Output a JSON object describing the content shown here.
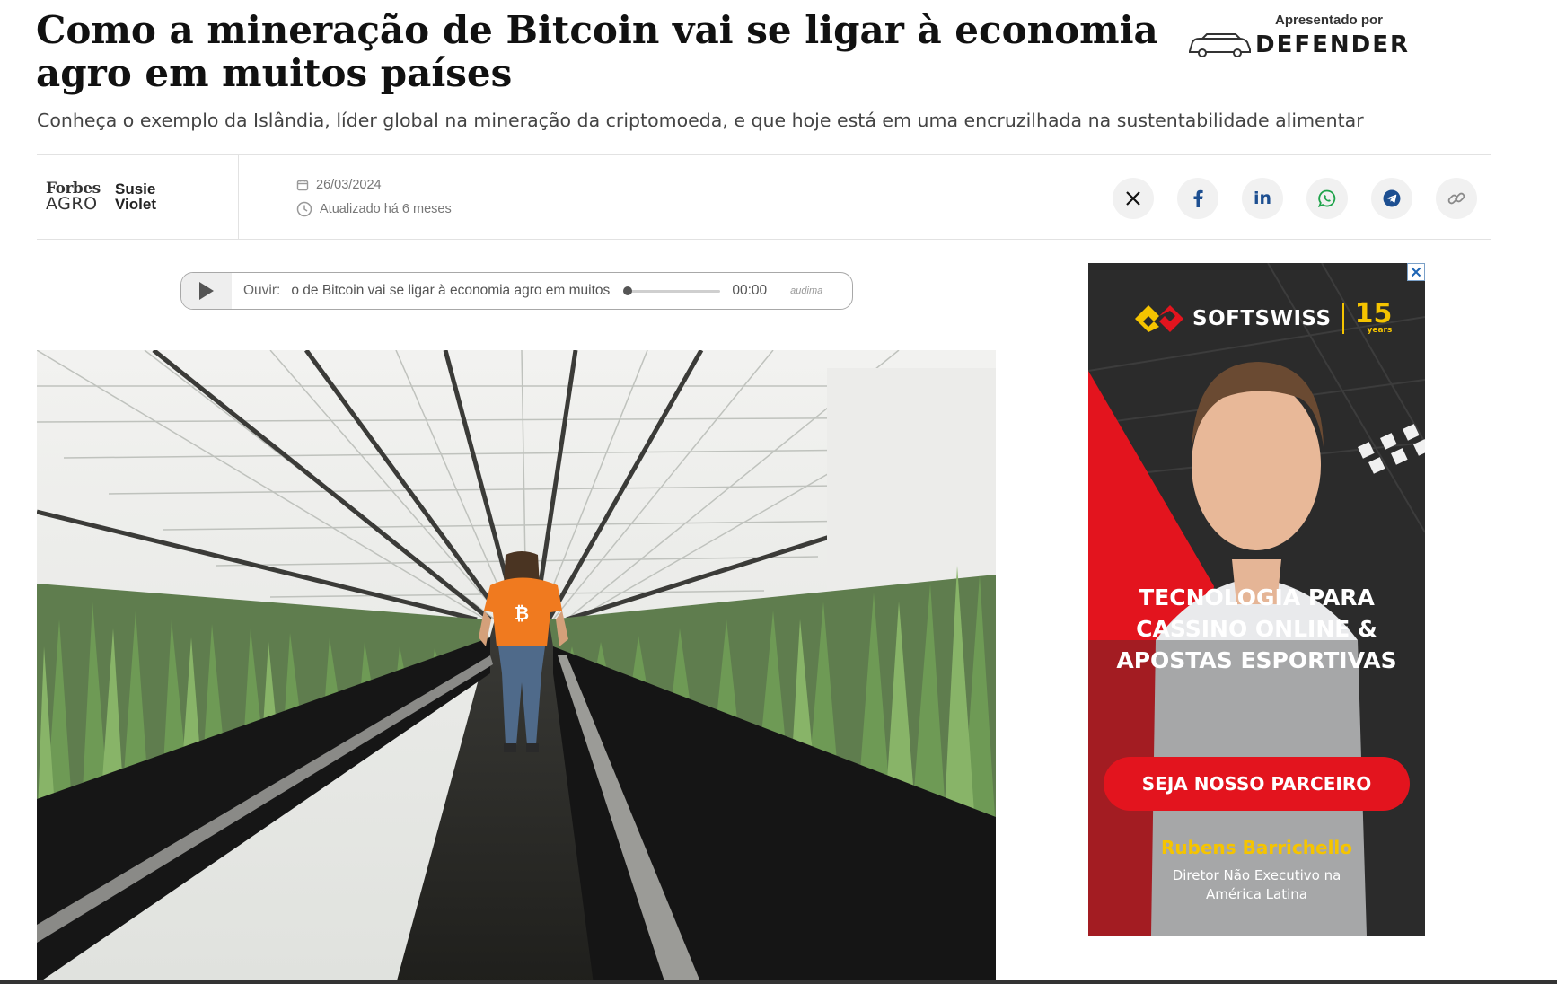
{
  "article": {
    "headline": "Como a mineração de Bitcoin vai se ligar à economia agro em muitos países",
    "subtitle": "Conheça o exemplo da Islândia, líder global na mineração da criptomoeda, e que hoje está em uma encruzilhada na sustentabilidade alimentar"
  },
  "sponsor": {
    "caption": "Apresentado por",
    "name": "DEFENDER"
  },
  "byline": {
    "brand_line1": "Forbes",
    "brand_line2": "AGRO",
    "author_first": "Susie",
    "author_last": "Violet",
    "date": "26/03/2024",
    "updated": "Atualizado há 6 meses"
  },
  "share": {
    "icons": [
      "x-icon",
      "facebook-icon",
      "linkedin-icon",
      "whatsapp-icon",
      "telegram-icon",
      "link-icon"
    ],
    "linkedin_label": "in"
  },
  "player": {
    "label": "Ouvir:",
    "title": "o de Bitcoin vai se ligar à economia agro em muitos",
    "time": "00:00",
    "brand": "audima",
    "progress": 0
  },
  "ad": {
    "brand": "SOFTSWISS",
    "years": "15",
    "years_caption": "years",
    "headline_line1": "TECNOLOGIA PARA",
    "headline_line2": "CASSINO ONLINE &",
    "headline_line3": "APOSTAS ESPORTIVAS",
    "cta": "SEJA NOSSO PARCEIRO",
    "person_name": "Rubens Barrichello",
    "person_role_line1": "Diretor Não Executivo na",
    "person_role_line2": "América Latina",
    "close_icon": "close-icon",
    "colors": {
      "red": "#e3141e",
      "yellow": "#f5c400",
      "dark": "#2a2a2a"
    }
  },
  "hero": {
    "shirt_mark": "₿"
  }
}
